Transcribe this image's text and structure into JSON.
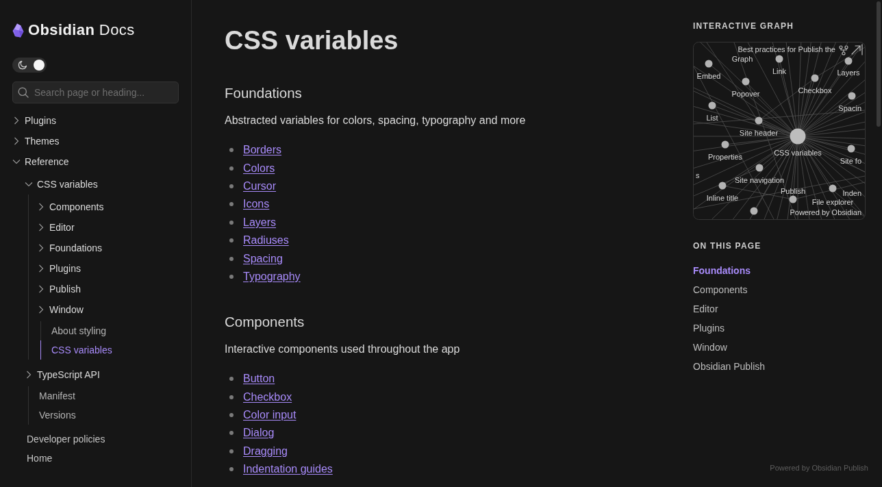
{
  "site": {
    "title": "**Obsidian** Docs"
  },
  "theme_toggle": {
    "on": true
  },
  "search": {
    "placeholder": "Search page or heading..."
  },
  "nav": [
    {
      "label": "Plugins",
      "kind": "folder",
      "expanded": false,
      "selected": false
    },
    {
      "label": "Themes",
      "kind": "folder",
      "expanded": false,
      "selected": false
    },
    {
      "label": "Reference",
      "kind": "folder",
      "expanded": true,
      "selected": false,
      "children": [
        {
          "label": "CSS variables",
          "kind": "folder",
          "expanded": true,
          "selected": false,
          "children": [
            {
              "label": "Components",
              "kind": "folder",
              "expanded": false,
              "selected": false
            },
            {
              "label": "Editor",
              "kind": "folder",
              "expanded": false,
              "selected": false
            },
            {
              "label": "Foundations",
              "kind": "folder",
              "expanded": false,
              "selected": false
            },
            {
              "label": "Plugins",
              "kind": "folder",
              "expanded": false,
              "selected": false
            },
            {
              "label": "Publish",
              "kind": "folder",
              "expanded": false,
              "selected": false
            },
            {
              "label": "Window",
              "kind": "folder",
              "expanded": false,
              "selected": false
            },
            {
              "label": "About styling",
              "kind": "file",
              "selected": false
            },
            {
              "label": "CSS variables",
              "kind": "file",
              "selected": true
            }
          ]
        },
        {
          "label": "TypeScript API",
          "kind": "folder",
          "expanded": false,
          "selected": false
        },
        {
          "label": "Manifest",
          "kind": "file",
          "selected": false
        },
        {
          "label": "Versions",
          "kind": "file",
          "selected": false
        }
      ]
    },
    {
      "label": "Developer policies",
      "kind": "file",
      "selected": false
    },
    {
      "label": "Home",
      "kind": "file",
      "selected": false
    }
  ],
  "page": {
    "title": "CSS variables",
    "sections": [
      {
        "heading": "Foundations",
        "intro": "Abstracted variables for colors, spacing, typography and more",
        "links": [
          "Borders",
          "Colors",
          "Cursor",
          "Icons",
          "Layers",
          "Radiuses",
          "Spacing",
          "Typography"
        ]
      },
      {
        "heading": "Components",
        "intro": "Interactive components used throughout the app",
        "links": [
          "Button",
          "Checkbox",
          "Color input",
          "Dialog",
          "Dragging",
          "Indentation guides"
        ]
      }
    ]
  },
  "graph": {
    "title": "INTERACTIVE GRAPH",
    "nodes": [
      {
        "kind": "label",
        "label": "Best practices for Publish the"
      },
      {
        "kind": "label",
        "label": "Graph"
      },
      {
        "kind": "page",
        "label": "Embed"
      },
      {
        "kind": "page",
        "label": "Link"
      },
      {
        "kind": "page",
        "label": "Layers"
      },
      {
        "kind": "page",
        "label": "Popover"
      },
      {
        "kind": "page",
        "label": "Checkbox"
      },
      {
        "kind": "page",
        "label": "List"
      },
      {
        "kind": "page",
        "label": "Spacin"
      },
      {
        "kind": "page",
        "label": "Site header"
      },
      {
        "kind": "current",
        "label": "CSS variables"
      },
      {
        "kind": "page",
        "label": "Properties"
      },
      {
        "kind": "page",
        "label": "Site fo"
      },
      {
        "kind": "label",
        "label": "s"
      },
      {
        "kind": "page",
        "label": "Site navigation"
      },
      {
        "kind": "page",
        "label": "Inline title"
      },
      {
        "kind": "label",
        "label": "Inden"
      },
      {
        "kind": "page",
        "label": "File explorer"
      },
      {
        "kind": "page",
        "label": "Publish"
      },
      {
        "kind": "dot"
      },
      {
        "kind": "label",
        "label": "Powered by Obsidian"
      }
    ]
  },
  "toc": {
    "title": "ON THIS PAGE",
    "items": [
      {
        "label": "Foundations",
        "selected": true
      },
      {
        "label": "Components",
        "selected": false
      },
      {
        "label": "Editor",
        "selected": false
      },
      {
        "label": "Plugins",
        "selected": false
      },
      {
        "label": "Window",
        "selected": false
      },
      {
        "label": "Obsidian Publish",
        "selected": false
      }
    ]
  },
  "footer": "Powered by Obsidian Publish"
}
